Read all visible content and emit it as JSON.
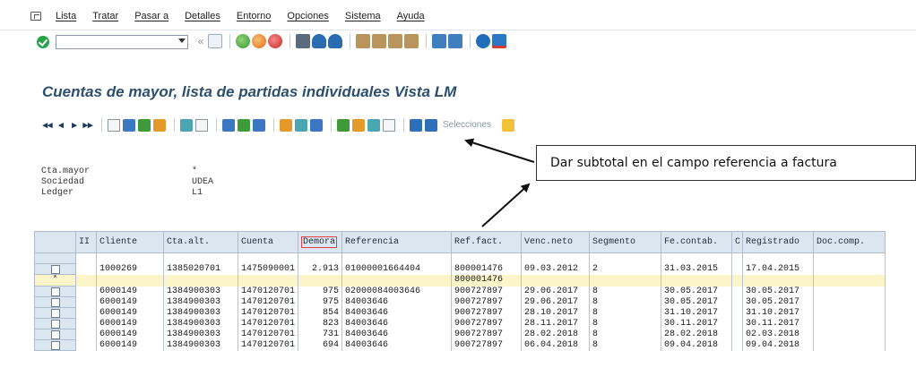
{
  "menu": {
    "items": [
      "Lista",
      "Tratar",
      "Pasar a",
      "Detalles",
      "Entorno",
      "Opciones",
      "Sistema",
      "Ayuda"
    ]
  },
  "window": {
    "title": "Cuentas de mayor, lista de partidas individuales Vista LM"
  },
  "app_toolbar": {
    "selections_label": "Selecciones"
  },
  "header_info": [
    {
      "label": "Cta.mayor",
      "value": "*"
    },
    {
      "label": "Sociedad",
      "value": "UDEA"
    },
    {
      "label": "Ledger",
      "value": "L1"
    }
  ],
  "annotation": {
    "text": "Dar subtotal en el campo referencia a factura"
  },
  "table": {
    "columns": [
      "II",
      "Cliente",
      "Cta.alt.",
      "Cuenta",
      "Demora",
      "Referencia",
      "Ref.fact.",
      "Venc.neto",
      "Segmento",
      "Fe.contab.",
      "C",
      "Registrado",
      "Doc.comp."
    ],
    "highlighted_column": "Demora",
    "rows": [
      {
        "type": "item",
        "cells": [
          "",
          "1000269",
          "1385020701",
          "1475090001",
          "2.913",
          "01000001664404",
          "800001476",
          "09.03.2012",
          "2",
          "31.03.2015",
          "",
          "17.04.2015",
          ""
        ]
      },
      {
        "type": "subtotal",
        "marker": "*",
        "cells": [
          "",
          "",
          "",
          "",
          "",
          "",
          "800001476",
          "",
          "",
          "",
          "",
          "",
          ""
        ]
      },
      {
        "type": "item",
        "cells": [
          "",
          "6000149",
          "1384900303",
          "1470120701",
          "975",
          "02000084003646",
          "900727897",
          "29.06.2017",
          "8",
          "30.05.2017",
          "",
          "30.05.2017",
          ""
        ]
      },
      {
        "type": "item",
        "cells": [
          "",
          "6000149",
          "1384900303",
          "1470120701",
          "975",
          "84003646",
          "900727897",
          "29.06.2017",
          "8",
          "30.05.2017",
          "",
          "30.05.2017",
          ""
        ]
      },
      {
        "type": "item",
        "cells": [
          "",
          "6000149",
          "1384900303",
          "1470120701",
          "854",
          "84003646",
          "900727897",
          "28.10.2017",
          "8",
          "31.10.2017",
          "",
          "31.10.2017",
          ""
        ]
      },
      {
        "type": "item",
        "cells": [
          "",
          "6000149",
          "1384900303",
          "1470120701",
          "823",
          "84003646",
          "900727897",
          "28.11.2017",
          "8",
          "30.11.2017",
          "",
          "30.11.2017",
          ""
        ]
      },
      {
        "type": "item",
        "cells": [
          "",
          "6000149",
          "1384900303",
          "1470120701",
          "731",
          "84003646",
          "900727897",
          "28.02.2018",
          "8",
          "28.02.2018",
          "",
          "02.03.2018",
          ""
        ]
      },
      {
        "type": "item",
        "cells": [
          "",
          "6000149",
          "1384900303",
          "1470120701",
          "694",
          "84003646",
          "900727897",
          "06.04.2018",
          "8",
          "09.04.2018",
          "",
          "09.04.2018",
          ""
        ]
      }
    ]
  }
}
